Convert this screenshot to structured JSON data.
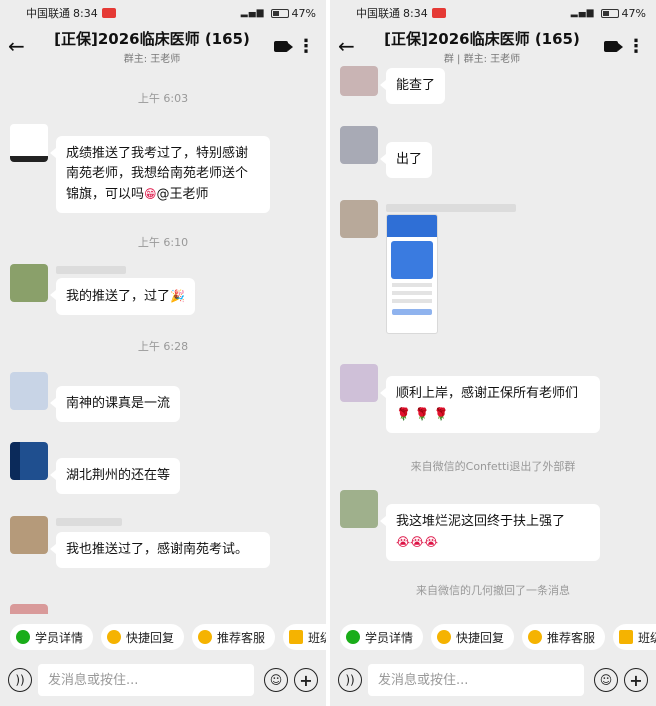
{
  "status": {
    "carrier": "中国联通",
    "time": "8:34",
    "battery": "47%"
  },
  "header": {
    "title": "[正保]2026临床医师",
    "count": "(165)",
    "subtitle_left": "群主: 王老师",
    "subtitle_right": "群 | 群主: 王老师"
  },
  "left_chat": {
    "time1": "上午 6:03",
    "msg1": "成绩推送了我考过了，特别感谢南苑老师，我想给南苑老师送个锦旗，可以吗",
    "msg1_mention": "@王老师",
    "time2": "上午 6:10",
    "msg2": "我的推送了，过了",
    "time3": "上午 6:28",
    "msg3": "南神的课真是一流",
    "msg4": "湖北荆州的还在等",
    "msg5": "我也推送过了，感谢南苑考试。"
  },
  "right_chat": {
    "msg1": "能查了",
    "msg2": "出了",
    "msg3": "顺利上岸，感谢正保所有老师们",
    "sys1": "来自微信的Confetti退出了外部群",
    "msg4": "我这堆烂泥这回终于扶上强了",
    "sys2": "来自微信的几何撤回了一条消息"
  },
  "quick": {
    "chip1": "学员详情",
    "chip2": "快捷回复",
    "chip3": "推荐客服",
    "chip4": "班级"
  },
  "input": {
    "placeholder": "发消息或按住..."
  },
  "colors": {
    "bg": "#ededed",
    "bubble": "#ffffff",
    "accent_green": "#1aad19",
    "accent_yellow": "#f5b301"
  }
}
